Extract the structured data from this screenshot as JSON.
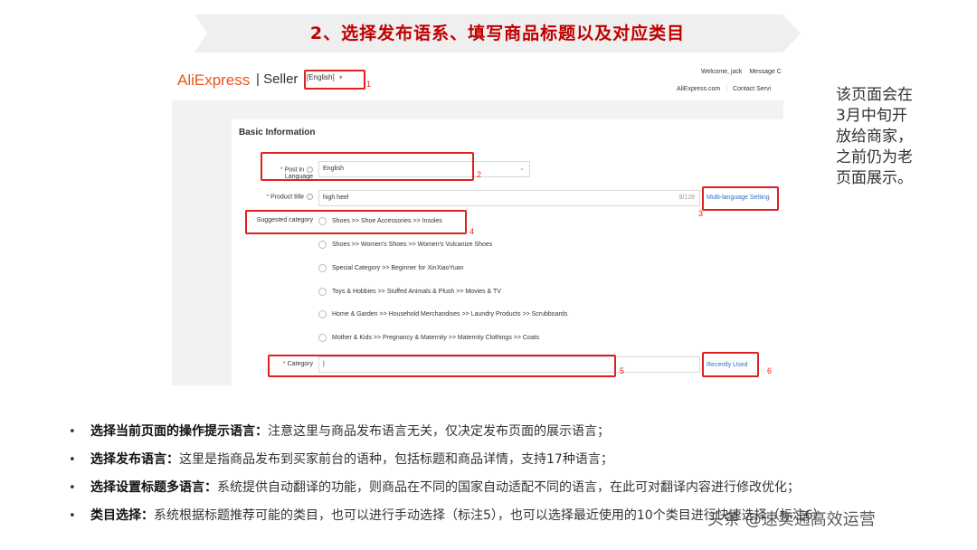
{
  "banner": {
    "title": "2、选择发布语系、填写商品标题以及对应类目"
  },
  "header": {
    "logo_text": "AliExpress",
    "seller_label": "| Seller",
    "language_select": "[English]",
    "welcome_text": "Welcome, jack",
    "message_link": "Message C",
    "site_link": "AliExpress.com",
    "contact_link": "Contact Servi"
  },
  "form": {
    "section_title": "Basic Information",
    "post_in_language_label_1": "Post in",
    "post_in_language_label_2": "Language",
    "language_value": "English",
    "product_title_label": "Product title",
    "product_title_value": "high heel",
    "char_count": "9/128",
    "multi_language_link": "Multi-language Setting",
    "suggested_category_label": "Suggested category",
    "suggested_categories": [
      "Shoes >> Shoe Accessories >> Insoles",
      "Shoes >> Women's Shoes >> Women's Vulcanize Shoes",
      "Special Category >> Beginner for XinXiaoYuan",
      "Toys & Hobbies >> Stuffed Animals & Plush >> Movies & TV",
      "Home & Garden >> Household Merchandises >> Laundry Products >> Scrubboards",
      "Mother & Kids >> Pregnancy & Maternity >> Maternity Clothings >> Coats"
    ],
    "category_label": "Category",
    "category_value": "|",
    "recently_used_link": "Recently Used"
  },
  "callout_numbers": [
    "1",
    "2",
    "3",
    "4",
    "5",
    "6"
  ],
  "side_note": "该页面会在\n3月中旬开\n放给商家，\n之前仍为老\n页面展示。",
  "bullets": [
    {
      "bold": "选择当前页面的操作提示语言：",
      "text": "注意这里与商品发布语言无关，仅决定发布页面的展示语言；"
    },
    {
      "bold": "选择发布语言：",
      "text": "这里是指商品发布到买家前台的语种，包括标题和商品详情，支持17种语言；"
    },
    {
      "bold": "选择设置标题多语言：",
      "text": "系统提供自动翻译的功能，则商品在不同的国家自动适配不同的语言，在此可对翻译内容进行修改优化；"
    },
    {
      "bold": "类目选择：",
      "text": "系统根据标题推荐可能的类目，也可以进行手动选择（标注5），也可以选择最近使用的10个类目进行快速选择（标注6）"
    }
  ],
  "bullet_symbol": "•",
  "watermark": "头条 @速卖通高效运营",
  "colors": {
    "banner_text": "#c00000",
    "callout": "#e02020",
    "logo": "#e8571e",
    "link": "#2e6fc7"
  }
}
